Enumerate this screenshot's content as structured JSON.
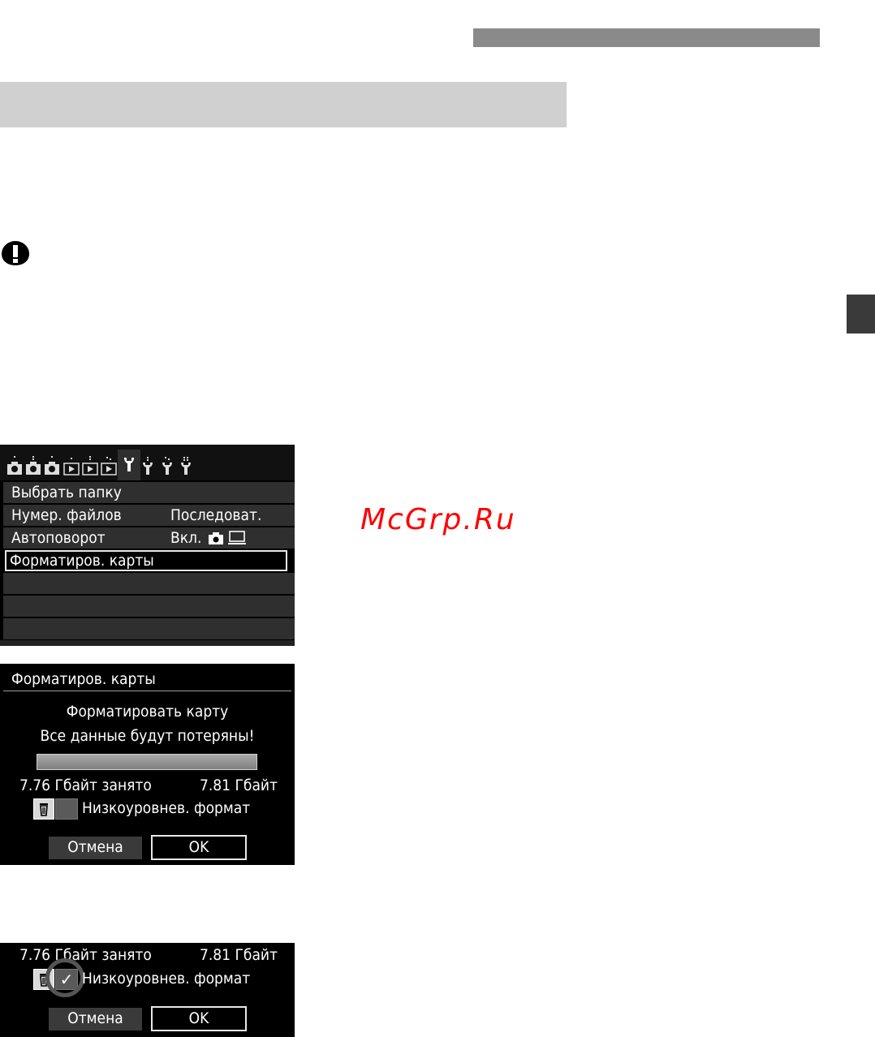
{
  "page": {
    "watermark": "McGrp.Ru",
    "icons": {
      "caution": "caution-icon"
    },
    "colors": {
      "top_bar": "#8a8a8a",
      "section_band": "#d0d0d0",
      "side_tab": "#3a3a3a",
      "watermark": "#ff0000"
    }
  },
  "menu_screen": {
    "tabs": [
      {
        "icon": "camera-icon",
        "dots": 1
      },
      {
        "icon": "camera-icon",
        "dots": 2
      },
      {
        "icon": "camera-icon",
        "dots": 3
      },
      {
        "icon": "playback-icon",
        "dots": 1
      },
      {
        "icon": "playback-icon",
        "dots": 2
      },
      {
        "icon": "playback-icon",
        "dots": 3
      },
      {
        "icon": "wrench-icon",
        "dots": 1,
        "active": true
      },
      {
        "icon": "wrench-icon",
        "dots": 2
      },
      {
        "icon": "wrench-icon",
        "dots": 3
      },
      {
        "icon": "wrench-icon",
        "dots": 4
      }
    ],
    "items": [
      {
        "label": "Выбрать папку",
        "value": ""
      },
      {
        "label": "Нумер. файлов",
        "value": "Последоват."
      },
      {
        "label": "Автоповорот",
        "value": "Вкл."
      },
      {
        "label": "Форматиров. карты",
        "value": "",
        "selected": true
      }
    ]
  },
  "format_screen": {
    "title": "Форматиров. карты",
    "message_line1": "Форматировать карту",
    "message_line2": "Все данные будут потеряны!",
    "used": "7.76 Гбайт занято",
    "total": "7.81 Гбайт",
    "low_level_label": "Низкоуровнев. формат",
    "low_level_checked": false,
    "cancel_label": "Отмена",
    "ok_label": "OK"
  },
  "crop_screen": {
    "used": "7.76 Гбайт занято",
    "total": "7.81 Гбайт",
    "low_level_label": "Низкоуровнев. формат",
    "check_mark": "✓",
    "low_level_checked": true,
    "cancel_label": "Отмена",
    "ok_label": "OK"
  }
}
